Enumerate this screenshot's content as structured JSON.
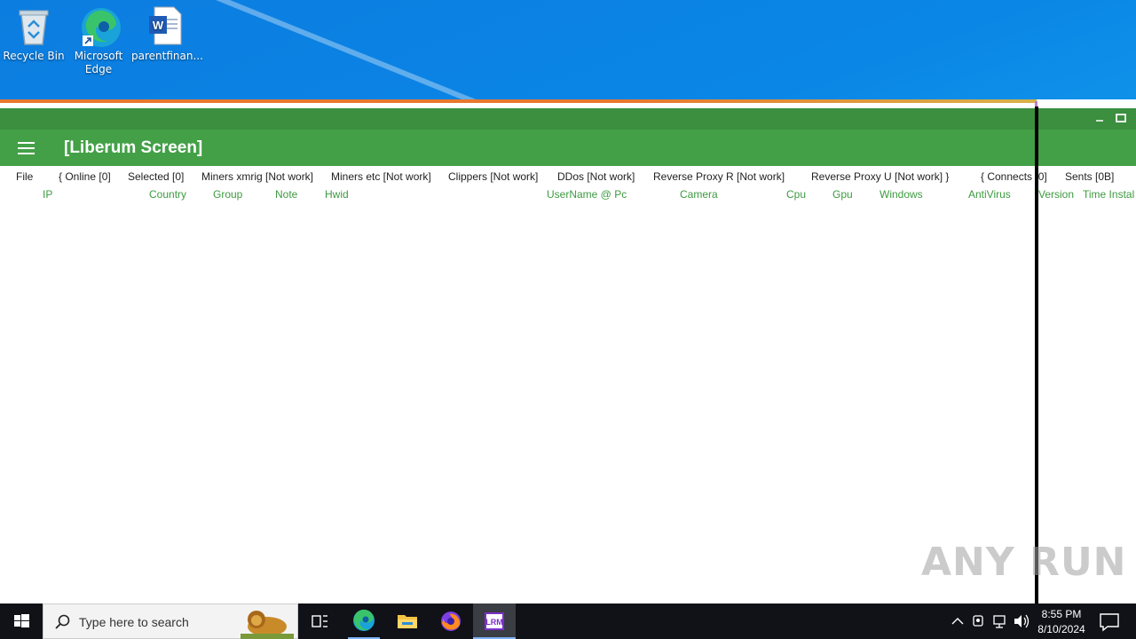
{
  "desktop": {
    "icons": [
      {
        "label": "Recycle Bin"
      },
      {
        "label": "Microsoft Edge"
      },
      {
        "label": "parentfinan..."
      }
    ]
  },
  "app": {
    "title": "[Liberum Screen]",
    "menu": [
      "File",
      "{ Online [0]",
      "Selected [0]",
      "Miners xmrig [Not work]",
      "Miners etc [Not work]",
      "Clippers [Not work]",
      "DDos [Not work]",
      "Reverse Proxy R [Not work]",
      "Reverse Proxy U [Not work] }",
      "{ Connects [0]",
      "Sents [0B]"
    ],
    "columns": [
      "IP",
      "Country",
      "Group",
      "Note",
      "Hwid",
      "UserName @ Pc",
      "Camera",
      "Cpu",
      "Gpu",
      "Windows",
      "AntiVirus",
      "Version",
      "Time Instal"
    ],
    "accent_color": "#43a047"
  },
  "taskbar": {
    "search_placeholder": "Type here to search",
    "clock_time": "8:55 PM",
    "clock_date": "8/10/2024"
  },
  "watermark": "ANY RUN"
}
